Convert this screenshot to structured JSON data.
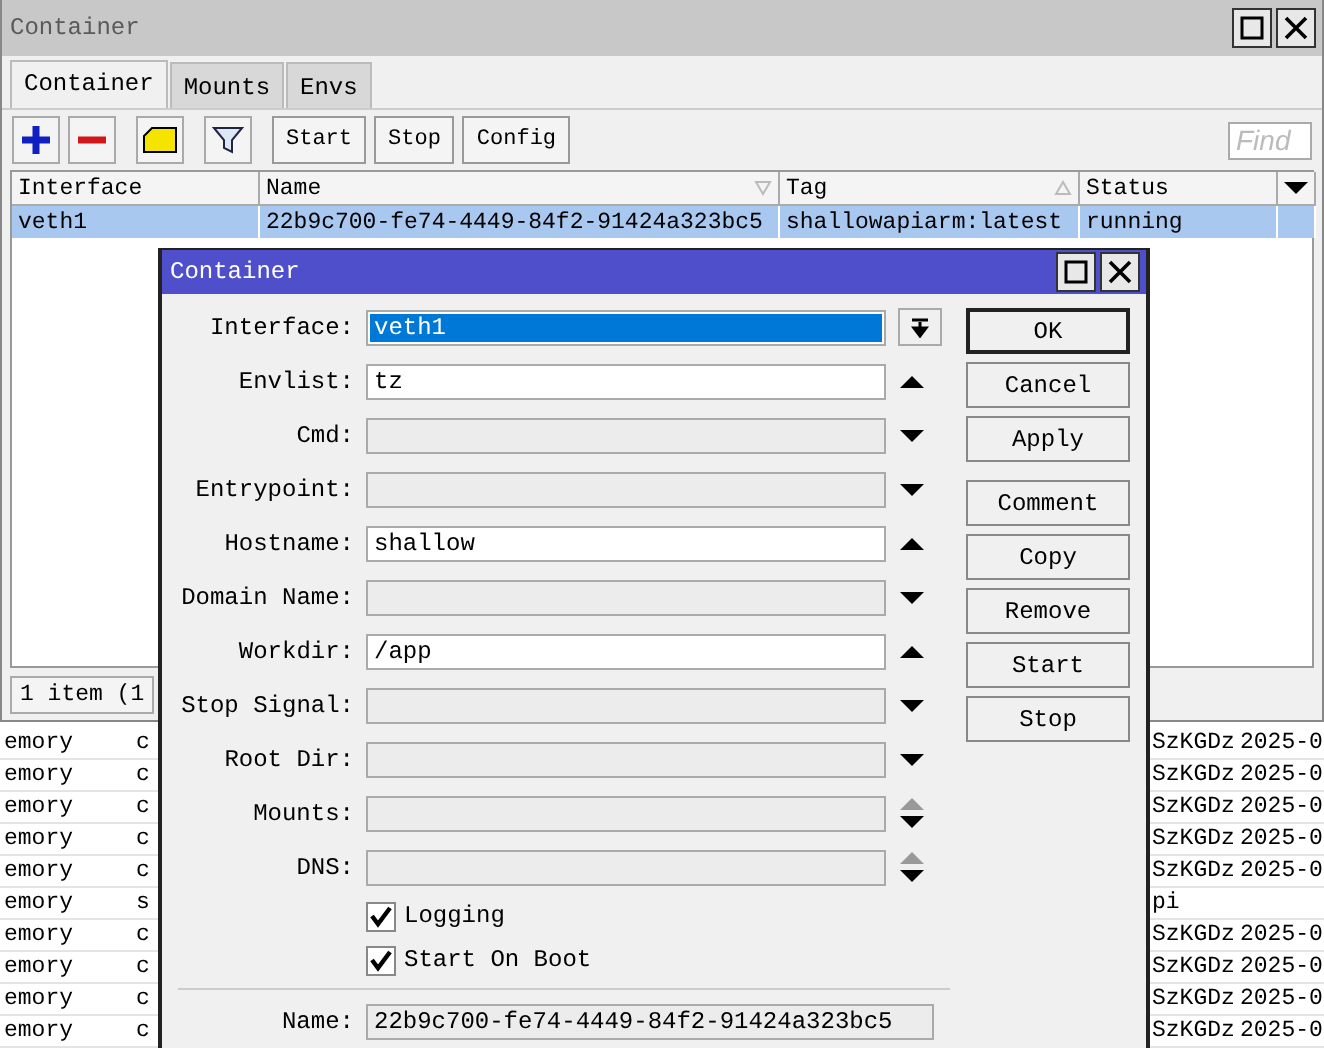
{
  "main_window": {
    "title": "Container",
    "tabs": [
      {
        "label": "Container",
        "selected": true
      },
      {
        "label": "Mounts",
        "selected": false
      },
      {
        "label": "Envs",
        "selected": false
      }
    ],
    "toolbar": {
      "buttons": [
        "Start",
        "Stop",
        "Config"
      ],
      "find": {
        "placeholder": "Find"
      }
    },
    "table": {
      "columns": [
        {
          "label": "Interface",
          "ascending": false,
          "descending": false
        },
        {
          "label": "Name",
          "ascending": false,
          "descending": true
        },
        {
          "label": "Tag",
          "ascending": true,
          "descending": false
        },
        {
          "label": "Status",
          "ascending": false,
          "descending": false
        }
      ],
      "rows": [
        {
          "cells": [
            "veth1",
            "22b9c700-fe74-4449-84f2-91424a323bc5",
            "shallowapiarm:latest",
            "running"
          ],
          "selected": true
        }
      ]
    },
    "status_bar": "1 item (1"
  },
  "log_rows": [
    {
      "column_1": "emory",
      "column_2": "c",
      "column_3": "SzKGDz",
      "column_4": "2025-0"
    },
    {
      "column_1": "emory",
      "column_2": "c",
      "column_3": "SzKGDz",
      "column_4": "2025-0"
    },
    {
      "column_1": "emory",
      "column_2": "c",
      "column_3": "SzKGDz",
      "column_4": "2025-0"
    },
    {
      "column_1": "emory",
      "column_2": "c",
      "column_3": "SzKGDz",
      "column_4": "2025-0"
    },
    {
      "column_1": "emory",
      "column_2": "c",
      "column_3": "SzKGDz",
      "column_4": "2025-0"
    },
    {
      "column_1": "emory",
      "column_2": "s",
      "column_3": "pi"
    },
    {
      "column_1": "emory",
      "column_2": "c",
      "column_3": "SzKGDz",
      "column_4": "2025-0"
    },
    {
      "column_1": "emory",
      "column_2": "c",
      "column_3": "SzKGDz",
      "column_4": "2025-0"
    },
    {
      "column_1": "emory",
      "column_2": "c",
      "column_3": "SzKGDz",
      "column_4": "2025-0"
    },
    {
      "column_1": "emory",
      "column_2": "c",
      "column_3": "SzKGDz",
      "column_4": "2025-0"
    }
  ],
  "dialog": {
    "title": "Container",
    "fields": [
      {
        "label": "Interface:",
        "value": "veth1",
        "kind": "dropdown",
        "selected": true
      },
      {
        "label": "Envlist:",
        "value": "tz",
        "kind": "up",
        "selected": false
      },
      {
        "label": "Cmd:",
        "kind": "down"
      },
      {
        "label": "Entrypoint:",
        "kind": "down"
      },
      {
        "label": "Hostname:",
        "value": "shallow",
        "kind": "up",
        "selected": false
      },
      {
        "label": "Domain Name:",
        "kind": "down"
      },
      {
        "label": "Workdir:",
        "value": "/app",
        "kind": "up",
        "selected": false
      },
      {
        "label": "Stop Signal:",
        "kind": "down"
      },
      {
        "label": "Root Dir:",
        "kind": "down"
      },
      {
        "label": "Mounts:",
        "kind": "updown"
      },
      {
        "label": "DNS:",
        "kind": "updown"
      }
    ],
    "checkboxes": [
      {
        "label": "Logging",
        "checked": true
      },
      {
        "label": "Start On Boot",
        "checked": true
      }
    ],
    "name": {
      "label": "Name:",
      "value": "22b9c700-fe74-4449-84f2-91424a323bc5"
    },
    "button_groups": [
      [
        {
          "label": "OK",
          "default": true
        },
        {
          "label": "Cancel",
          "default": false
        },
        {
          "label": "Apply",
          "default": false
        }
      ],
      [
        {
          "label": "Comment",
          "default": false
        },
        {
          "label": "Copy",
          "default": false
        },
        {
          "label": "Remove",
          "default": false
        },
        {
          "label": "Start",
          "default": false
        },
        {
          "label": "Stop",
          "default": false
        }
      ]
    ]
  }
}
